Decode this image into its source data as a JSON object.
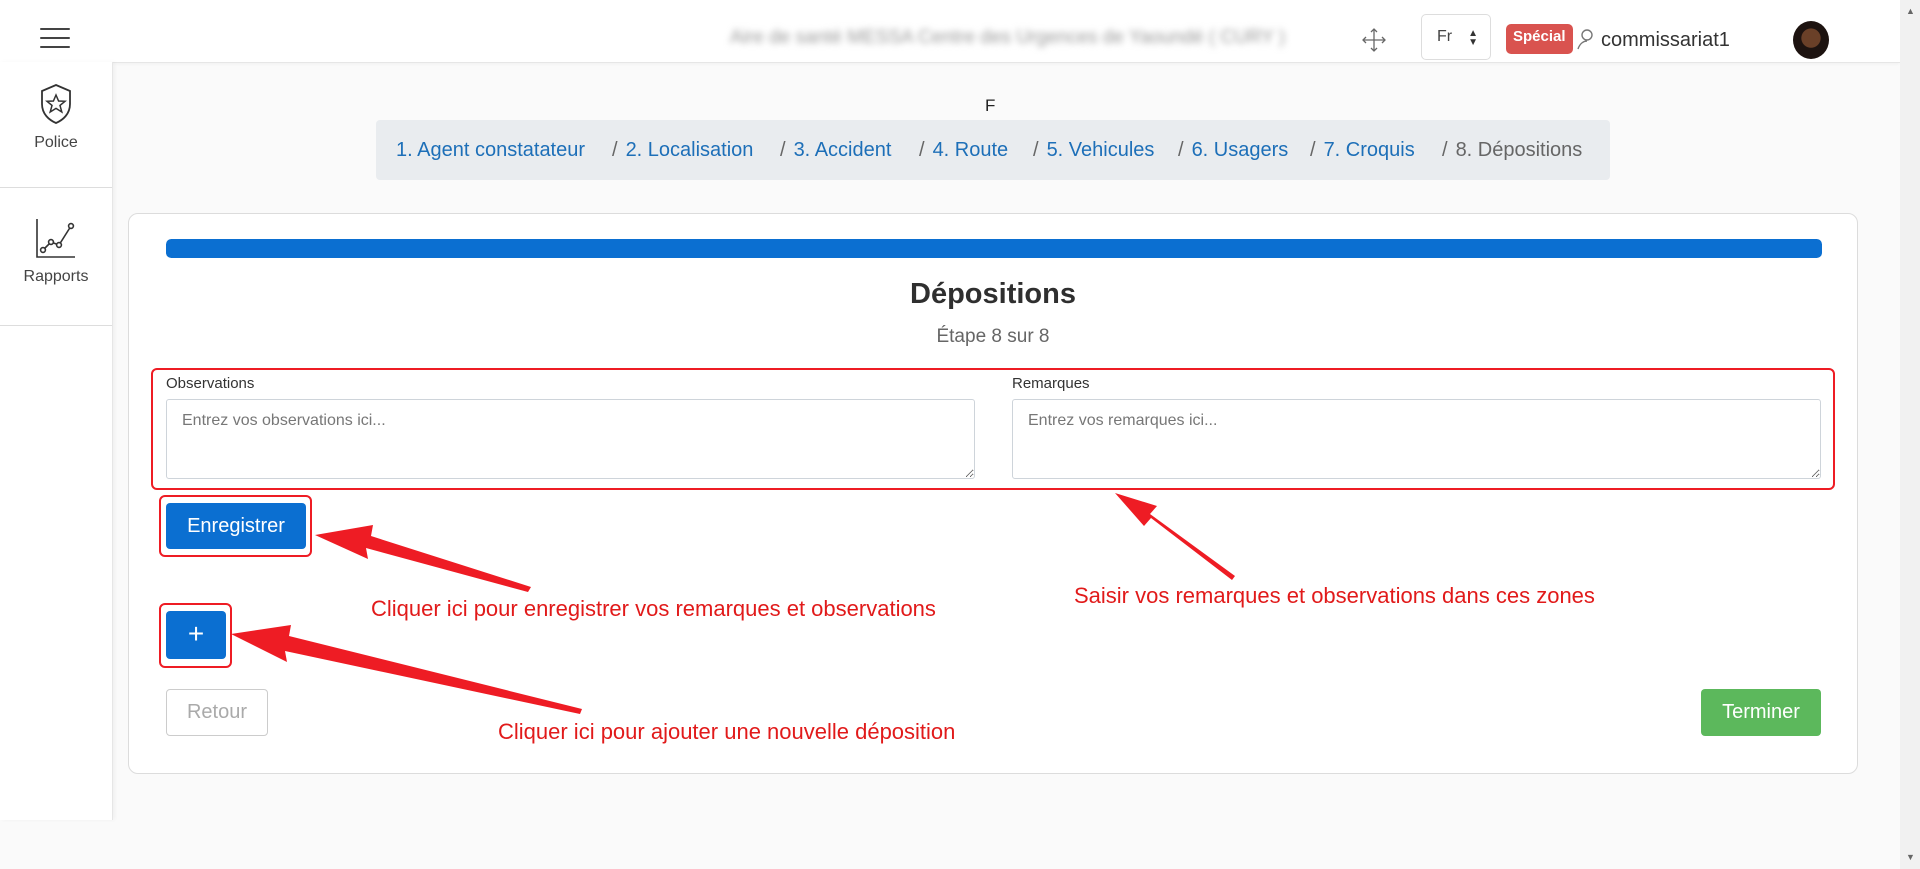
{
  "topbar": {
    "facility": "Aire de santé MESSA Centre des Urgences de Yaoundé ( CURY )",
    "language": "Fr",
    "badge": "Spécial",
    "username": "commissariat1"
  },
  "sidebar": {
    "items": [
      {
        "label": "Police",
        "icon": "police-badge-icon"
      },
      {
        "label": "Rapports",
        "icon": "line-chart-icon"
      }
    ]
  },
  "wizard": {
    "letter": "F",
    "steps": [
      "1. Agent constatateur",
      "2. Localisation",
      "3. Accident",
      "4. Route",
      "5. Vehicules",
      "6. Usagers",
      "7. Croquis",
      "8. Dépositions"
    ],
    "separator": "/",
    "current_step": 8,
    "total_steps": 8,
    "progress_fraction": 1.0,
    "title": "Dépositions",
    "subtitle": "Étape 8 sur 8"
  },
  "form": {
    "observations_label": "Observations",
    "observations_placeholder": "Entrez vos observations ici...",
    "remarques_label": "Remarques",
    "remarques_placeholder": "Entrez vos remarques ici...",
    "save_label": "Enregistrer",
    "add_label": "+",
    "back_label": "Retour",
    "finish_label": "Terminer"
  },
  "annotations": {
    "save_hint": "Cliquer ici pour enregistrer vos remarques et observations",
    "fields_hint": "Saisir vos remarques et observations dans ces zones",
    "add_hint": "Cliquer ici pour ajouter une nouvelle déposition",
    "color": "#ee1c24"
  },
  "colors": {
    "primary": "#0b6fd1",
    "success": "#5cb85c",
    "badge": "#d9534f",
    "link": "#1d6fb8"
  }
}
